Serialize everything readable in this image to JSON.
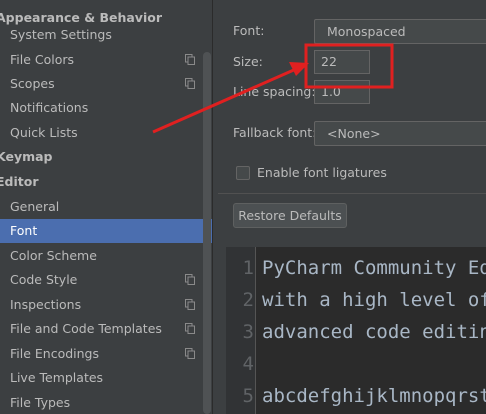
{
  "sidebar": {
    "items": [
      {
        "label": "Appearance & Behavior",
        "kind": "section",
        "scope": false
      },
      {
        "label": "System Settings",
        "kind": "item",
        "scope": false
      },
      {
        "label": "File Colors",
        "kind": "item",
        "scope": true
      },
      {
        "label": "Scopes",
        "kind": "item",
        "scope": true
      },
      {
        "label": "Notifications",
        "kind": "item",
        "scope": false
      },
      {
        "label": "Quick Lists",
        "kind": "item",
        "scope": false
      },
      {
        "label": "Keymap",
        "kind": "section",
        "scope": false
      },
      {
        "label": "Editor",
        "kind": "section",
        "scope": false
      },
      {
        "label": "General",
        "kind": "item",
        "scope": false
      },
      {
        "label": "Font",
        "kind": "item",
        "scope": false,
        "selected": true
      },
      {
        "label": "Color Scheme",
        "kind": "item",
        "scope": false
      },
      {
        "label": "Code Style",
        "kind": "item",
        "scope": true
      },
      {
        "label": "Inspections",
        "kind": "item",
        "scope": true
      },
      {
        "label": "File and Code Templates",
        "kind": "item",
        "scope": true
      },
      {
        "label": "File Encodings",
        "kind": "item",
        "scope": true
      },
      {
        "label": "Live Templates",
        "kind": "item",
        "scope": false
      },
      {
        "label": "File Types",
        "kind": "item",
        "scope": false
      }
    ]
  },
  "font_settings": {
    "font_label": "Font:",
    "font_value": "Monospaced",
    "size_label": "Size:",
    "size_value": "22",
    "line_spacing_label": "Line spacing:",
    "line_spacing_value": "1.0",
    "fallback_label": "Fallback font:",
    "fallback_value": "<None>",
    "ligatures_label": "Enable font ligatures",
    "ligatures_checked": false,
    "restore_label": "Restore Defaults"
  },
  "preview": {
    "lines": [
      {
        "num": "1",
        "text": "PyCharm Community Edi"
      },
      {
        "num": "2",
        "text": "with a high level of"
      },
      {
        "num": "3",
        "text": "advanced code editing"
      },
      {
        "num": "4",
        "text": ""
      },
      {
        "num": "5",
        "text": "abcdefghijklmnopqrstu"
      }
    ]
  },
  "colors": {
    "background": "#3c3f41",
    "selection": "#4b6eaf",
    "editor_bg": "#2b2b2b",
    "annotation": "#e02020"
  }
}
